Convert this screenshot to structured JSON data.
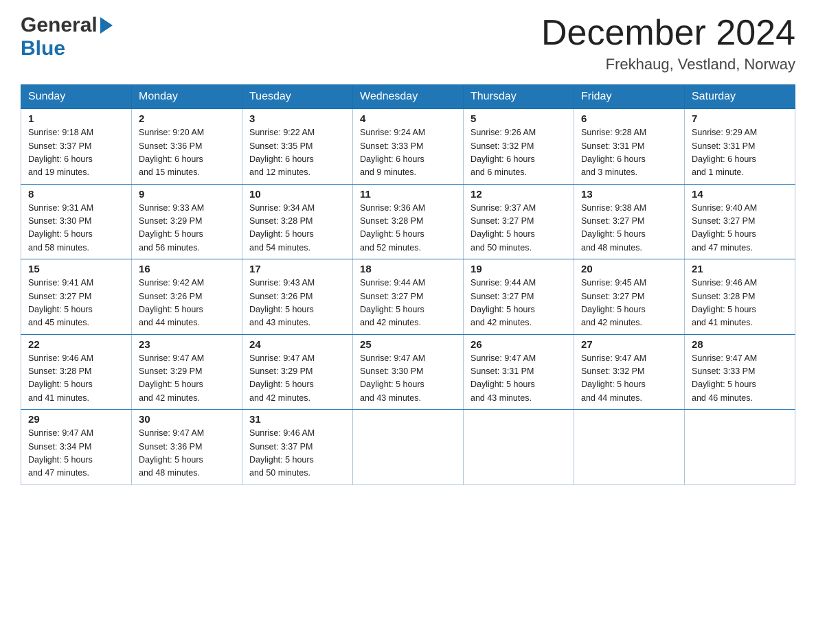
{
  "header": {
    "month_year": "December 2024",
    "location": "Frekhaug, Vestland, Norway"
  },
  "days_of_week": [
    "Sunday",
    "Monday",
    "Tuesday",
    "Wednesday",
    "Thursday",
    "Friday",
    "Saturday"
  ],
  "weeks": [
    [
      {
        "day": "1",
        "sunrise": "9:18 AM",
        "sunset": "3:37 PM",
        "daylight": "6 hours and 19 minutes."
      },
      {
        "day": "2",
        "sunrise": "9:20 AM",
        "sunset": "3:36 PM",
        "daylight": "6 hours and 15 minutes."
      },
      {
        "day": "3",
        "sunrise": "9:22 AM",
        "sunset": "3:35 PM",
        "daylight": "6 hours and 12 minutes."
      },
      {
        "day": "4",
        "sunrise": "9:24 AM",
        "sunset": "3:33 PM",
        "daylight": "6 hours and 9 minutes."
      },
      {
        "day": "5",
        "sunrise": "9:26 AM",
        "sunset": "3:32 PM",
        "daylight": "6 hours and 6 minutes."
      },
      {
        "day": "6",
        "sunrise": "9:28 AM",
        "sunset": "3:31 PM",
        "daylight": "6 hours and 3 minutes."
      },
      {
        "day": "7",
        "sunrise": "9:29 AM",
        "sunset": "3:31 PM",
        "daylight": "6 hours and 1 minute."
      }
    ],
    [
      {
        "day": "8",
        "sunrise": "9:31 AM",
        "sunset": "3:30 PM",
        "daylight": "5 hours and 58 minutes."
      },
      {
        "day": "9",
        "sunrise": "9:33 AM",
        "sunset": "3:29 PM",
        "daylight": "5 hours and 56 minutes."
      },
      {
        "day": "10",
        "sunrise": "9:34 AM",
        "sunset": "3:28 PM",
        "daylight": "5 hours and 54 minutes."
      },
      {
        "day": "11",
        "sunrise": "9:36 AM",
        "sunset": "3:28 PM",
        "daylight": "5 hours and 52 minutes."
      },
      {
        "day": "12",
        "sunrise": "9:37 AM",
        "sunset": "3:27 PM",
        "daylight": "5 hours and 50 minutes."
      },
      {
        "day": "13",
        "sunrise": "9:38 AM",
        "sunset": "3:27 PM",
        "daylight": "5 hours and 48 minutes."
      },
      {
        "day": "14",
        "sunrise": "9:40 AM",
        "sunset": "3:27 PM",
        "daylight": "5 hours and 47 minutes."
      }
    ],
    [
      {
        "day": "15",
        "sunrise": "9:41 AM",
        "sunset": "3:27 PM",
        "daylight": "5 hours and 45 minutes."
      },
      {
        "day": "16",
        "sunrise": "9:42 AM",
        "sunset": "3:26 PM",
        "daylight": "5 hours and 44 minutes."
      },
      {
        "day": "17",
        "sunrise": "9:43 AM",
        "sunset": "3:26 PM",
        "daylight": "5 hours and 43 minutes."
      },
      {
        "day": "18",
        "sunrise": "9:44 AM",
        "sunset": "3:27 PM",
        "daylight": "5 hours and 42 minutes."
      },
      {
        "day": "19",
        "sunrise": "9:44 AM",
        "sunset": "3:27 PM",
        "daylight": "5 hours and 42 minutes."
      },
      {
        "day": "20",
        "sunrise": "9:45 AM",
        "sunset": "3:27 PM",
        "daylight": "5 hours and 42 minutes."
      },
      {
        "day": "21",
        "sunrise": "9:46 AM",
        "sunset": "3:28 PM",
        "daylight": "5 hours and 41 minutes."
      }
    ],
    [
      {
        "day": "22",
        "sunrise": "9:46 AM",
        "sunset": "3:28 PM",
        "daylight": "5 hours and 41 minutes."
      },
      {
        "day": "23",
        "sunrise": "9:47 AM",
        "sunset": "3:29 PM",
        "daylight": "5 hours and 42 minutes."
      },
      {
        "day": "24",
        "sunrise": "9:47 AM",
        "sunset": "3:29 PM",
        "daylight": "5 hours and 42 minutes."
      },
      {
        "day": "25",
        "sunrise": "9:47 AM",
        "sunset": "3:30 PM",
        "daylight": "5 hours and 43 minutes."
      },
      {
        "day": "26",
        "sunrise": "9:47 AM",
        "sunset": "3:31 PM",
        "daylight": "5 hours and 43 minutes."
      },
      {
        "day": "27",
        "sunrise": "9:47 AM",
        "sunset": "3:32 PM",
        "daylight": "5 hours and 44 minutes."
      },
      {
        "day": "28",
        "sunrise": "9:47 AM",
        "sunset": "3:33 PM",
        "daylight": "5 hours and 46 minutes."
      }
    ],
    [
      {
        "day": "29",
        "sunrise": "9:47 AM",
        "sunset": "3:34 PM",
        "daylight": "5 hours and 47 minutes."
      },
      {
        "day": "30",
        "sunrise": "9:47 AM",
        "sunset": "3:36 PM",
        "daylight": "5 hours and 48 minutes."
      },
      {
        "day": "31",
        "sunrise": "9:46 AM",
        "sunset": "3:37 PM",
        "daylight": "5 hours and 50 minutes."
      },
      null,
      null,
      null,
      null
    ]
  ],
  "labels": {
    "sunrise": "Sunrise:",
    "sunset": "Sunset:",
    "daylight": "Daylight:"
  }
}
